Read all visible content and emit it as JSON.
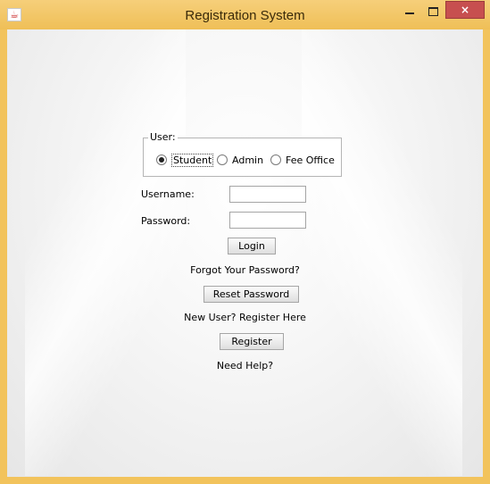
{
  "window": {
    "title": "Registration System",
    "close_glyph": "×"
  },
  "app_icon": "☕",
  "user_group": {
    "legend": "User:",
    "options": [
      {
        "label": "Student",
        "selected": true
      },
      {
        "label": "Admin",
        "selected": false
      },
      {
        "label": "Fee Office",
        "selected": false
      }
    ]
  },
  "form": {
    "username_label": "Username:",
    "username_value": "",
    "password_label": "Password:",
    "password_value": ""
  },
  "buttons": {
    "login": "Login",
    "reset_password": "Reset Password",
    "register": "Register"
  },
  "texts": {
    "forgot": "Forgot Your Password?",
    "new_user": "New User? Register Here",
    "help": "Need Help?"
  }
}
